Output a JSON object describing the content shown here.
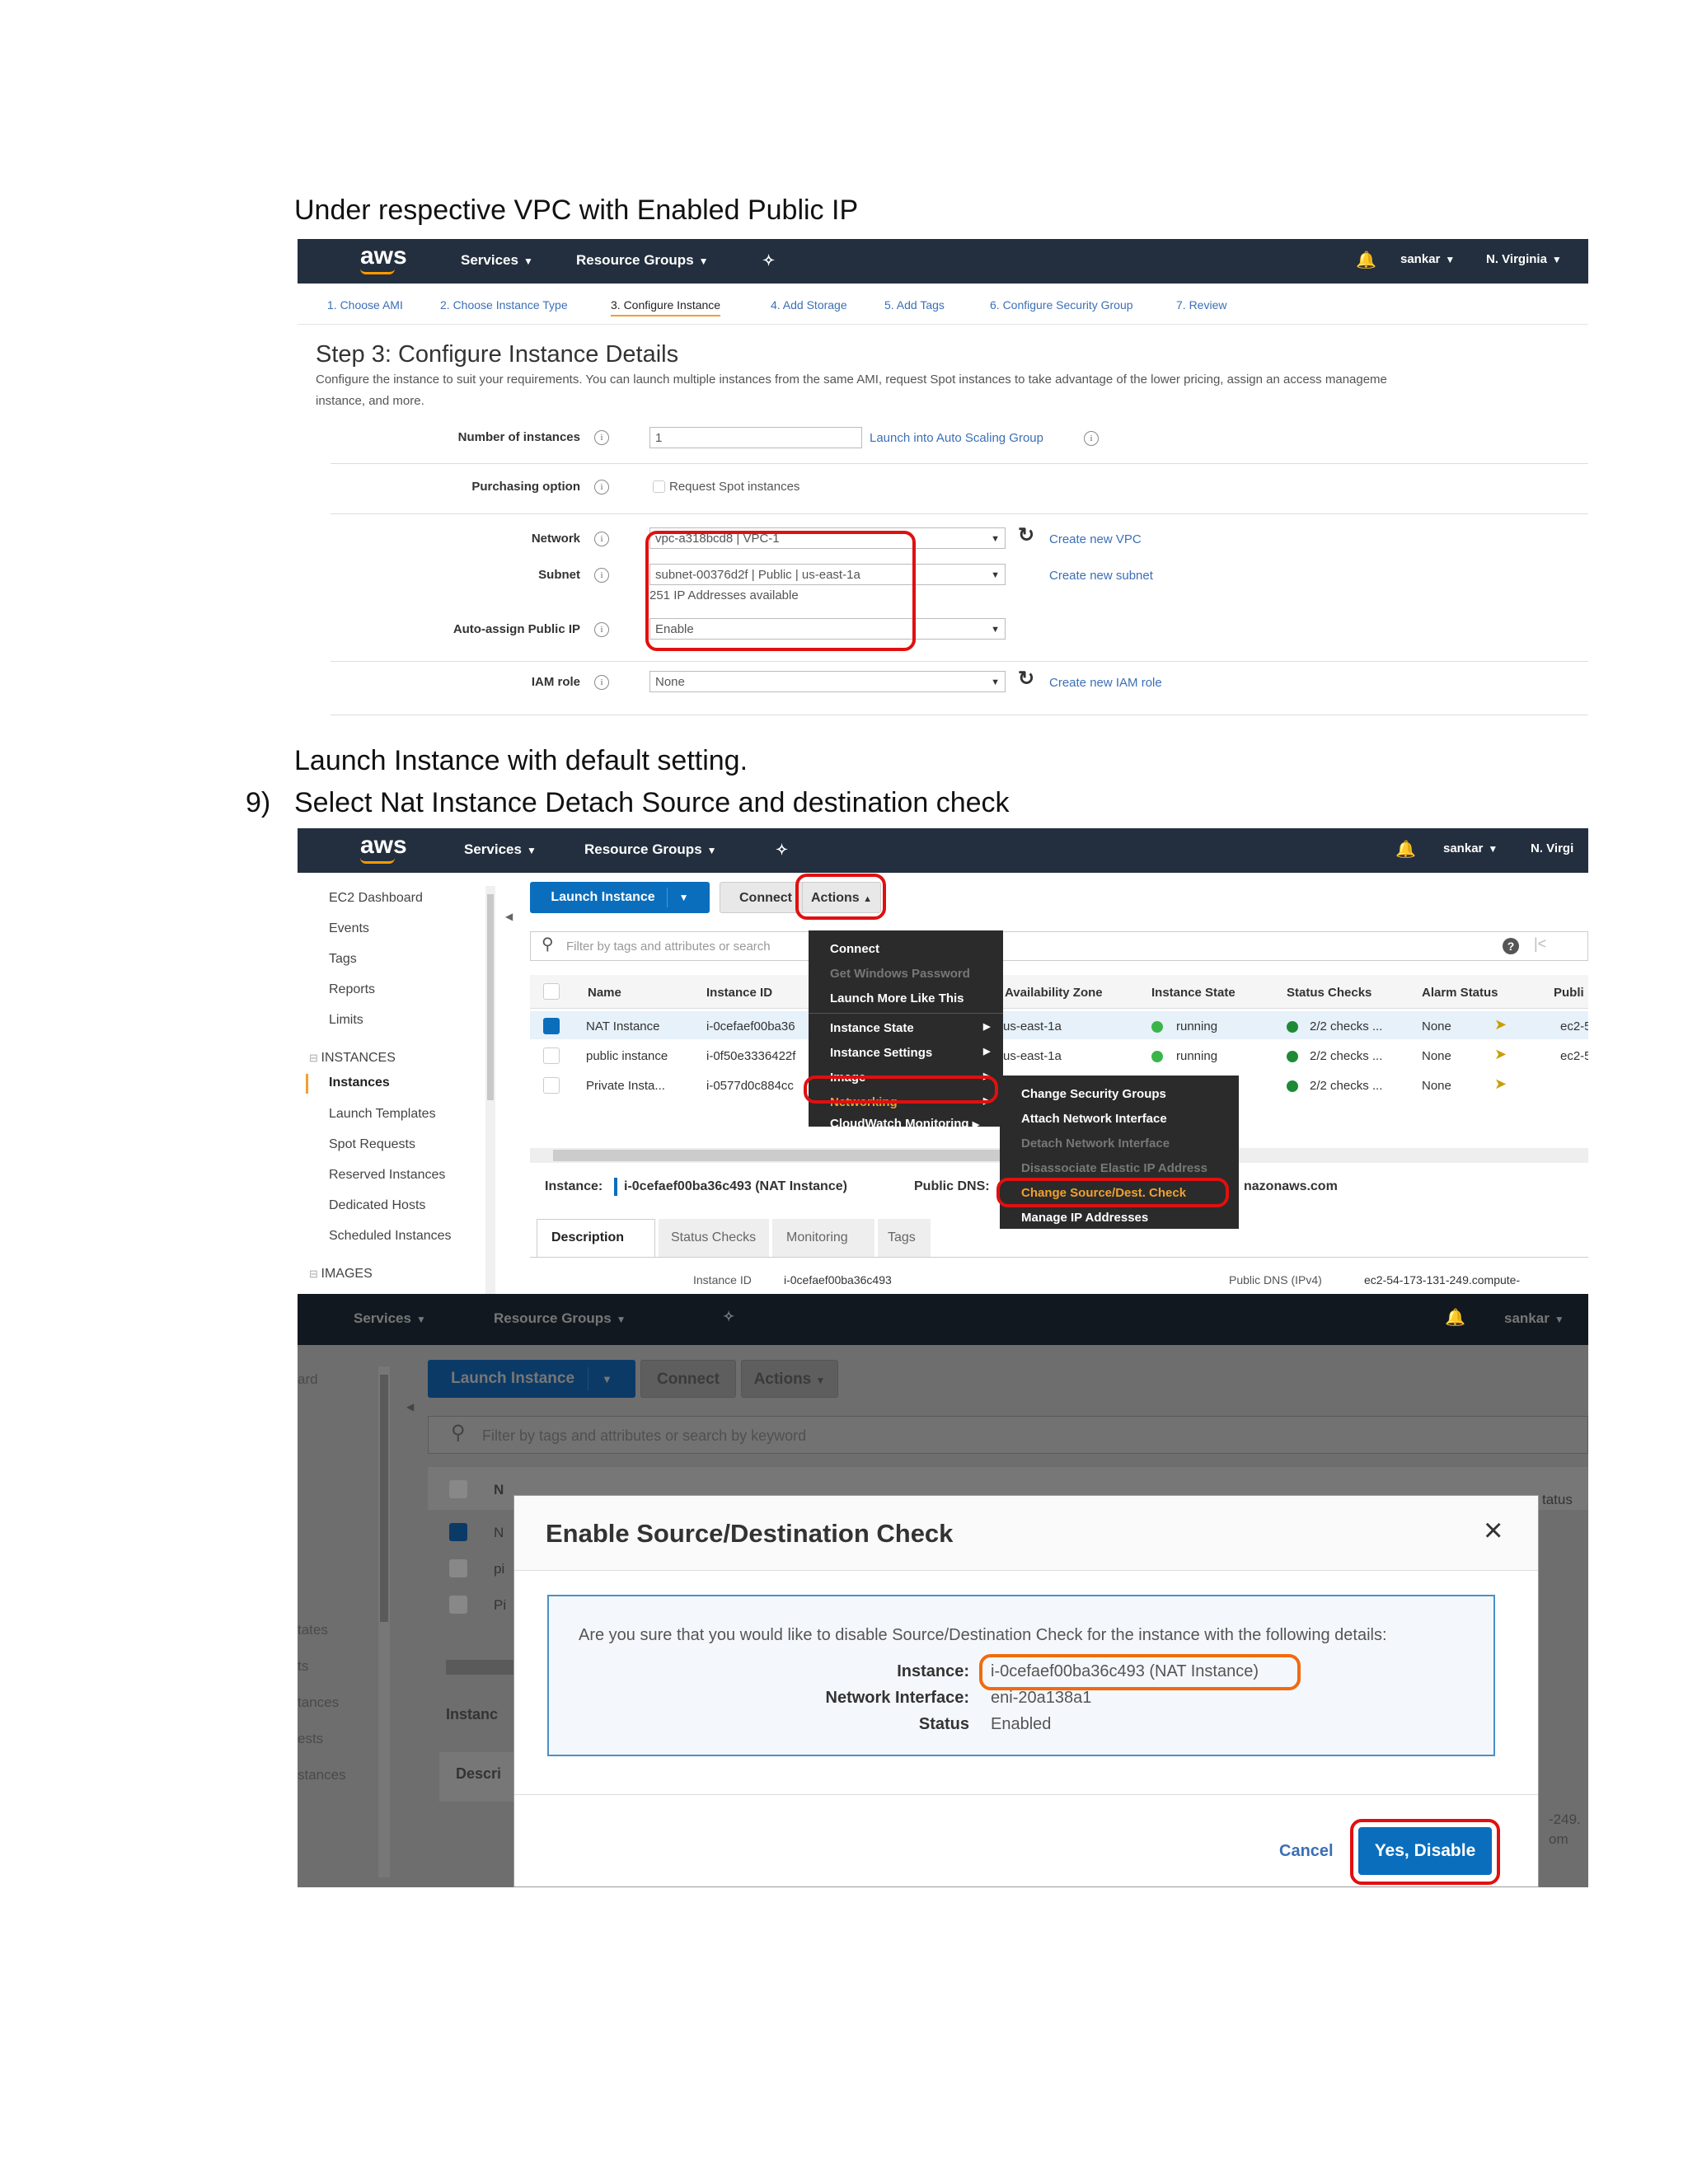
{
  "doc": {
    "line1": "Under respective VPC with Enabled Public IP",
    "line2": "Launch Instance  with default setting.",
    "step_number": "9)",
    "line3": "Select Nat Instance Detach Source and destination check"
  },
  "shot1": {
    "nav": {
      "logo": "aws",
      "services": "Services",
      "resource_groups": "Resource Groups",
      "user": "sankar",
      "region": "N. Virginia"
    },
    "steps": [
      "1. Choose AMI",
      "2. Choose Instance Type",
      "3. Configure Instance",
      "4. Add Storage",
      "5. Add Tags",
      "6. Configure Security Group",
      "7. Review"
    ],
    "title": "Step 3: Configure Instance Details",
    "desc1": "Configure the instance to suit your requirements. You can launch multiple instances from the same AMI, request Spot instances to take advantage of the lower pricing, assign an access manageme",
    "desc2": "instance, and more.",
    "num_instances_label": "Number of instances",
    "num_instances_value": "1",
    "asg_link": "Launch into Auto Scaling Group",
    "purchasing_label": "Purchasing option",
    "spot_label": "Request Spot instances",
    "network_label": "Network",
    "network_value": "vpc-a318bcd8 | VPC-1",
    "create_vpc": "Create new VPC",
    "subnet_label": "Subnet",
    "subnet_value": "subnet-00376d2f | Public | us-east-1a",
    "create_subnet": "Create new subnet",
    "ip_available": "251 IP Addresses available",
    "public_ip_label": "Auto-assign Public IP",
    "public_ip_value": "Enable",
    "iam_label": "IAM role",
    "iam_value": "None",
    "create_iam": "Create new IAM role"
  },
  "shot2": {
    "nav": {
      "logo": "aws",
      "services": "Services",
      "resource_groups": "Resource Groups",
      "user": "sankar",
      "region": "N. Virgi"
    },
    "sidebar": [
      "EC2 Dashboard",
      "Events",
      "Tags",
      "Reports",
      "Limits"
    ],
    "section_instances": "INSTANCES",
    "sidebar2": [
      "Instances",
      "Launch Templates",
      "Spot Requests",
      "Reserved Instances",
      "Dedicated Hosts",
      "Scheduled Instances"
    ],
    "section_images": "IMAGES",
    "launch": "Launch Instance",
    "connect": "Connect",
    "actions": "Actions",
    "filter": "Filter by tags and attributes or search",
    "columns": [
      "Name",
      "Instance ID",
      "Availability Zone",
      "Instance State",
      "Status Checks",
      "Alarm Status",
      "Publi"
    ],
    "rows": [
      {
        "name": "NAT Instance",
        "id": "i-0cefaef00ba36",
        "az": "us-east-1a",
        "state": "running",
        "checks": "2/2 checks ...",
        "alarm": "None",
        "dns": "ec2-5"
      },
      {
        "name": "public instance",
        "id": "i-0f50e3336422f",
        "az": "us-east-1a",
        "state": "running",
        "checks": "2/2 checks ...",
        "alarm": "None",
        "dns": "ec2-5"
      },
      {
        "name": "Private Insta...",
        "id": "i-0577d0c884cc",
        "az": "",
        "state": "",
        "checks": "2/2 checks ...",
        "alarm": "None",
        "dns": ""
      }
    ],
    "menu": [
      "Connect",
      "Get Windows Password",
      "Launch More Like This",
      "Instance State",
      "Instance Settings",
      "Image",
      "Networking",
      "CloudWatch Monitoring"
    ],
    "submenu": [
      "Change Security Groups",
      "Attach Network Interface",
      "Detach Network Interface",
      "Disassociate Elastic IP Address",
      "Change Source/Dest. Check",
      "Manage IP Addresses"
    ],
    "instance_label": "Instance:",
    "instance_value": "i-0cefaef00ba36c493 (NAT Instance)",
    "public_dns_label": "Public DNS:",
    "public_dns_value": "nazonaws.com",
    "tabs": [
      "Description",
      "Status Checks",
      "Monitoring",
      "Tags"
    ],
    "bottom_label": "Instance ID",
    "bottom_value": "i-0cefaef00ba36c493",
    "bottom_dns_label": "Public DNS (IPv4)",
    "bottom_dns_value": "ec2-54-173-131-249.compute-"
  },
  "shot3": {
    "nav": {
      "services": "Services",
      "resource_groups": "Resource Groups",
      "user": "sankar"
    },
    "launch": "Launch Instance",
    "connect": "Connect",
    "actions": "Actions",
    "filter": "Filter by tags and attributes or search by keyword",
    "sidebar": [
      "ard",
      "tates",
      "ts",
      "tances",
      "ests",
      "stances"
    ],
    "bg_col": "N",
    "bg_rows": [
      "N",
      "pi",
      "Pi"
    ],
    "bg_instance": "Instanc",
    "bg_desc": "Descri",
    "bg_right1": "tatus",
    "bg_right2": "-249.",
    "bg_right3": "om",
    "modal_title": "Enable Source/Destination Check",
    "message": "Are you sure that you would like to disable Source/Destination Check for the instance with the following details:",
    "instance_label": "Instance:",
    "instance_value": "i-0cefaef00ba36c493 (NAT Instance)",
    "ni_label": "Network Interface:",
    "ni_value": "eni-20a138a1",
    "status_label": "Status",
    "status_value": "Enabled",
    "cancel": "Cancel",
    "confirm": "Yes, Disable"
  }
}
